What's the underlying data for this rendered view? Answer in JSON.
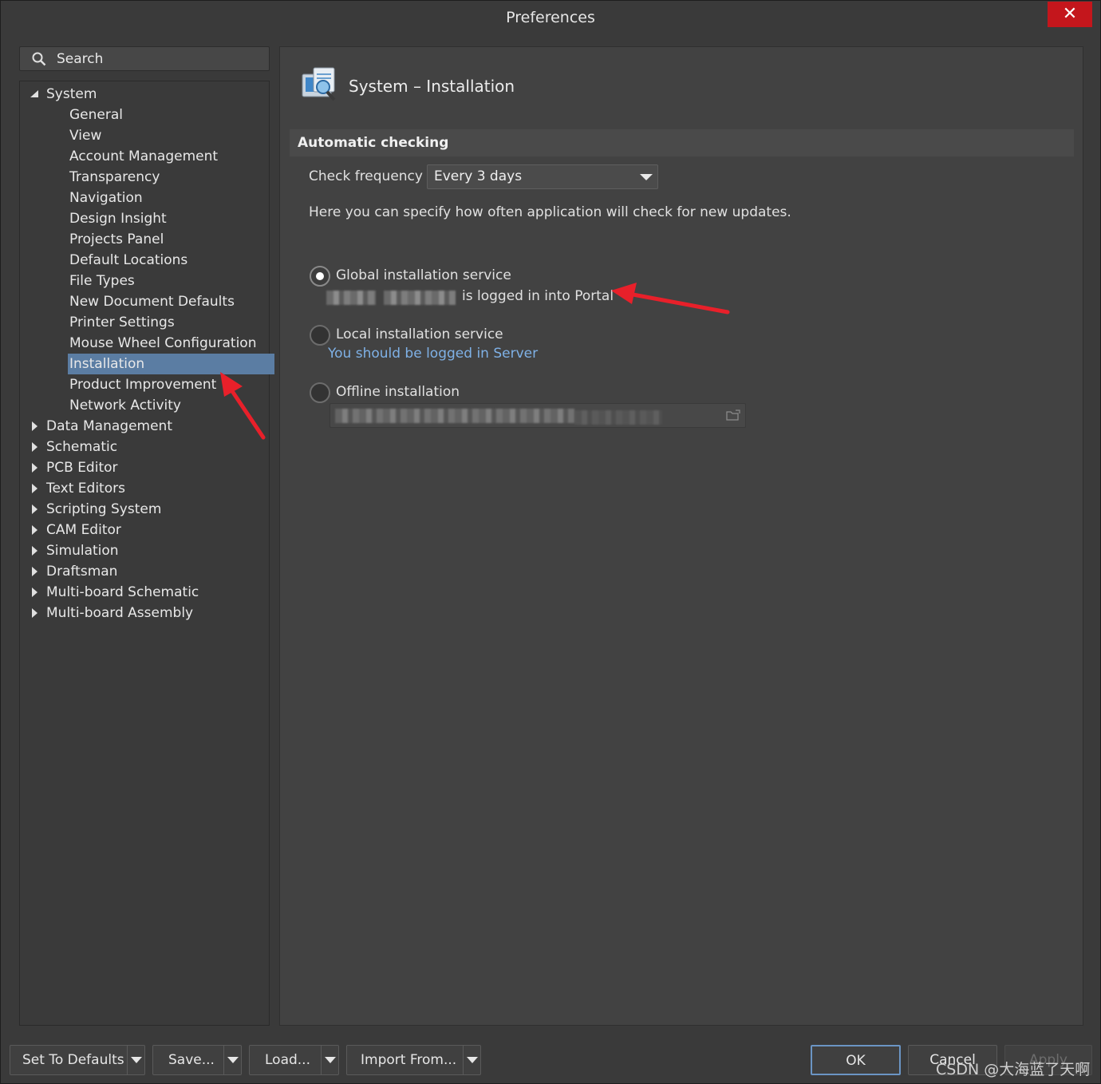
{
  "window": {
    "title": "Preferences"
  },
  "search": {
    "placeholder": "Search"
  },
  "tree": {
    "system": "System",
    "system_children": [
      "General",
      "View",
      "Account Management",
      "Transparency",
      "Navigation",
      "Design Insight",
      "Projects Panel",
      "Default Locations",
      "File Types",
      "New Document Defaults",
      "Printer Settings",
      "Mouse Wheel Configuration",
      "Installation",
      "Product Improvement",
      "Network Activity"
    ],
    "selected": "Installation",
    "other_roots": [
      "Data Management",
      "Schematic",
      "PCB Editor",
      "Text Editors",
      "Scripting System",
      "CAM Editor",
      "Simulation",
      "Draftsman",
      "Multi-board Schematic",
      "Multi-board Assembly"
    ]
  },
  "page": {
    "title": "System – Installation",
    "section_title": "Automatic checking",
    "check_frequency_label": "Check frequency",
    "check_frequency_value": "Every 3 days",
    "description": "Here you can specify how often application will check for new updates.",
    "global_service": {
      "label": "Global installation service",
      "status": "is logged in into Portal",
      "selected": true
    },
    "local_service": {
      "label": "Local installation service",
      "status": "You should be logged in Server",
      "selected": false
    },
    "offline": {
      "label": "Offline installation",
      "selected": false
    }
  },
  "footer": {
    "set_defaults": "Set To Defaults",
    "save": "Save...",
    "load": "Load...",
    "import": "Import From...",
    "ok": "OK",
    "cancel": "Cancel",
    "apply": "Apply",
    "watermark": "CSDN @大海蓝了天啊"
  },
  "colors": {
    "accent_selected": "#5b7da3",
    "close_button": "#c4161c",
    "annotation_arrow": "#e8202a"
  }
}
